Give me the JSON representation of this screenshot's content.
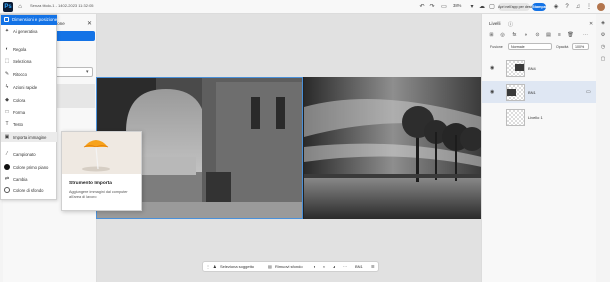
{
  "topbar": {
    "doc_title": "Senza titolo-1 - 1402-2023 11:32:05",
    "zoom": "38%",
    "open_desktop": "Apri nell'app per desktop",
    "share": "Stampa"
  },
  "properties": {
    "title": "Dimensioni e posizione",
    "panel_title": "zione"
  },
  "menu": {
    "header": "Dimensioni e posizione",
    "items": [
      {
        "label": "Ai generativa",
        "icon": "sparkle-icon"
      },
      {
        "label": "Regola",
        "icon": "adjust-icon"
      },
      {
        "label": "Seleziona",
        "icon": "select-icon"
      },
      {
        "label": "Ritocco",
        "icon": "brush-icon"
      },
      {
        "label": "Azioni rapide",
        "icon": "lightning-icon"
      },
      {
        "label": "Colora",
        "icon": "paint-icon"
      },
      {
        "label": "Forma",
        "icon": "shape-icon"
      },
      {
        "label": "Testo",
        "icon": "text-icon"
      },
      {
        "label": "Importa immagine",
        "icon": "import-image-icon"
      },
      {
        "label": "Campionato",
        "icon": "eyedropper-icon"
      },
      {
        "label": "Colore primo piano",
        "icon": "foreground-color-icon"
      },
      {
        "label": "Cambia",
        "icon": "swap-icon"
      },
      {
        "label": "Colore di sfondo",
        "icon": "background-color-icon"
      }
    ]
  },
  "tooltip": {
    "title": "Strumento Importa",
    "description": "Aggiungere immagini dal computer all'area di lavoro"
  },
  "context_bar": {
    "select_subject": "Seleziona soggetto",
    "remove_background": "Rimuovi sfondo",
    "more": "···",
    "layer_name": "BN1"
  },
  "layers": {
    "title": "Livelli",
    "blend_label": "Fusione",
    "blend_value": "Normale",
    "opacity_label": "Opacità",
    "opacity_value": "100%",
    "items": [
      {
        "name": "BN4",
        "selected": false
      },
      {
        "name": "BN1",
        "selected": true
      },
      {
        "name": "Livello 1",
        "selected": false
      }
    ]
  },
  "colors": {
    "accent": "#1473e6",
    "selection": "#4a90d9"
  }
}
